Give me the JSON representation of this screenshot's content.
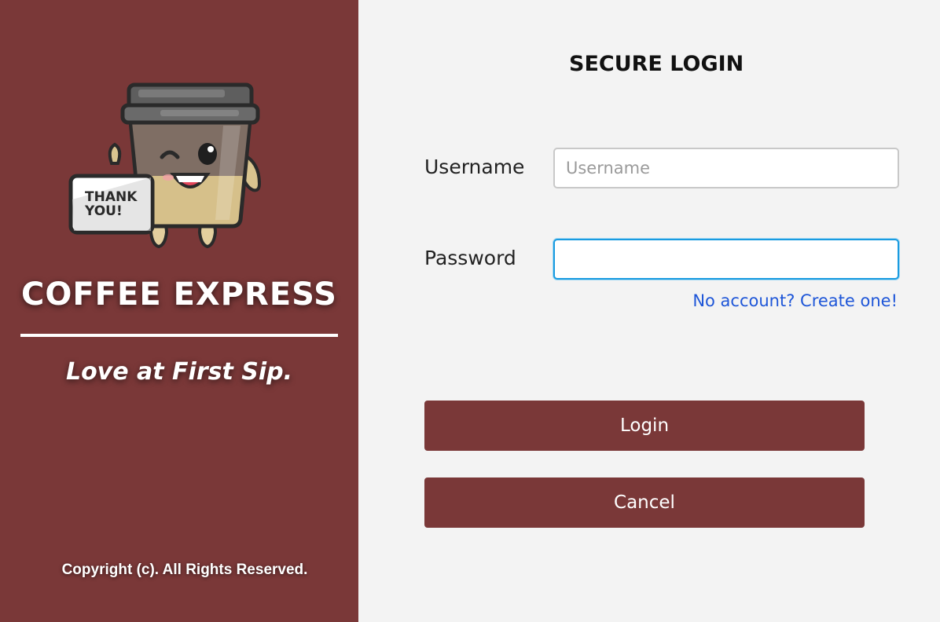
{
  "brand": {
    "name": "COFFEE EXPRESS",
    "tagline": "Love at First Sip.",
    "copyright": "Copyright (c). All Rights Reserved.",
    "mascot_sign_line1": "THANK",
    "mascot_sign_line2": "YOU!"
  },
  "login": {
    "title": "SECURE LOGIN",
    "username_label": "Username",
    "username_placeholder": "Username",
    "username_value": "",
    "password_label": "Password",
    "password_value": "",
    "signup_link": "No account? Create one!",
    "login_button": "Login",
    "cancel_button": "Cancel"
  },
  "colors": {
    "brand_panel": "#7a3838",
    "login_panel": "#f3f3f3",
    "button": "#7a3838",
    "link": "#1e56d8",
    "focus_border": "#1a9be0"
  },
  "icons": {
    "mascot": "coffee-cup-mascot-icon"
  }
}
